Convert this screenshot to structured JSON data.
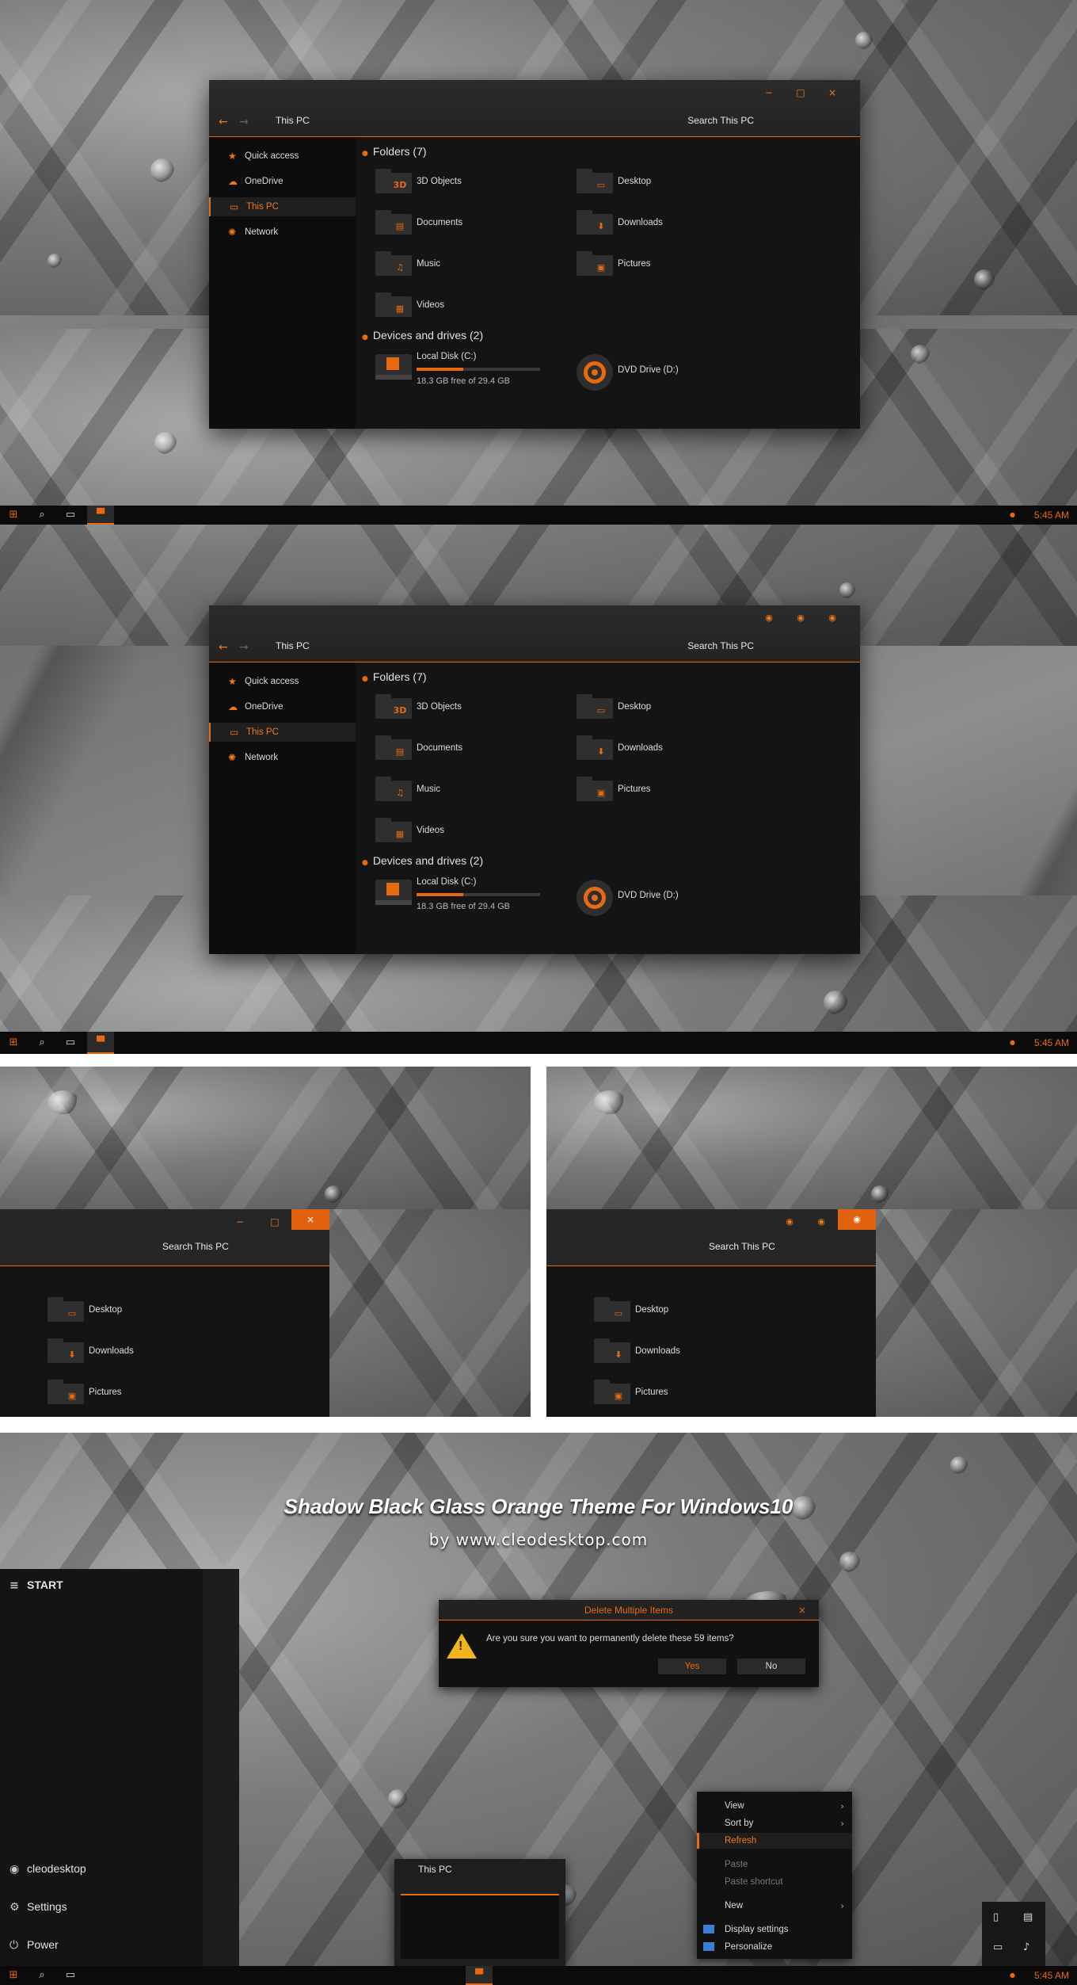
{
  "explorer": {
    "breadcrumb": "This PC",
    "search_placeholder": "Search This PC",
    "controls_top": {
      "minimize": "−",
      "maximize": "□",
      "close": "×"
    },
    "controls_alt": {
      "dot": "◉"
    },
    "nav": {
      "back": "←",
      "forward": "→"
    },
    "sidebar": [
      {
        "label": "Quick access",
        "icon": "star-icon",
        "glyph": "★"
      },
      {
        "label": "OneDrive",
        "icon": "cloud-icon",
        "glyph": "☁"
      },
      {
        "label": "This PC",
        "icon": "monitor-icon",
        "glyph": "▭",
        "selected": true
      },
      {
        "label": "Network",
        "icon": "network-icon",
        "glyph": "✺"
      }
    ],
    "folders_header": "Folders (7)",
    "folders": [
      {
        "label": "3D Objects",
        "glyph": "3D"
      },
      {
        "label": "Desktop",
        "glyph": "▭"
      },
      {
        "label": "Documents",
        "glyph": "▤"
      },
      {
        "label": "Downloads",
        "glyph": "⬇"
      },
      {
        "label": "Music",
        "glyph": "♫"
      },
      {
        "label": "Pictures",
        "glyph": "▣"
      },
      {
        "label": "Videos",
        "glyph": "▦"
      }
    ],
    "drives_header": "Devices and drives (2)",
    "drives": [
      {
        "label": "Local Disk (C:)",
        "free": "18.3 GB free of 29.4 GB",
        "used_fraction": 0.38
      },
      {
        "label": "DVD Drive (D:)"
      }
    ]
  },
  "taskbar": {
    "clock": "5:45 AM",
    "start_glyph": "⊞",
    "search_glyph": "⌕",
    "taskview_glyph": "▭",
    "explorer_glyph": "▀"
  },
  "crop_folders": [
    "Desktop",
    "Downloads",
    "Pictures"
  ],
  "promo": {
    "title": "Shadow Black Glass Orange Theme For Windows10",
    "byline": "by www.cleodesktop.com"
  },
  "start_menu": {
    "header": "START",
    "menu_glyph": "≡",
    "user": "cleodesktop",
    "settings": "Settings",
    "power": "Power"
  },
  "dialog": {
    "title": "Delete Multiple Items",
    "message": "Are you sure you want to permanently delete these 59 items?",
    "yes": "Yes",
    "no": "No",
    "close": "×"
  },
  "context_menu": {
    "items": [
      {
        "label": "View",
        "submenu": true
      },
      {
        "label": "Sort by",
        "submenu": true
      },
      {
        "label": "Refresh",
        "highlight": true
      },
      {
        "label": "Paste",
        "disabled": true
      },
      {
        "label": "Paste shortcut",
        "disabled": true
      },
      {
        "label": "New",
        "submenu": true
      },
      {
        "label": "Display settings",
        "icon": true
      },
      {
        "label": "Personalize",
        "icon": true
      }
    ]
  },
  "thumbnail": {
    "title": "This PC"
  },
  "colors": {
    "accent": "#e86a10",
    "dark": "#141414",
    "titlebar": "#262626"
  }
}
